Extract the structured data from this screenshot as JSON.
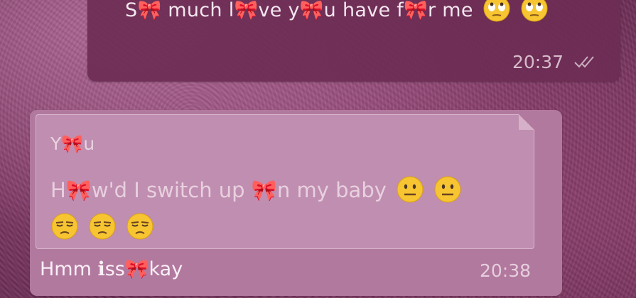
{
  "messages": {
    "outgoing": {
      "text": "S🎀 much l🎀ve y🎀u have f🎀r me",
      "emoji": [
        "face-with-rolling-eyes-emoji",
        "face-with-rolling-eyes-emoji"
      ],
      "time": "20:37",
      "status": "double-check-icon"
    },
    "incoming": {
      "quote": {
        "author": "Y🎀u",
        "text": "H🎀w'd I switch up 🎀n my baby",
        "emoji": [
          "neutral-face-emoji",
          "neutral-face-emoji",
          "unamused-face-emoji",
          "unamused-face-emoji",
          "unamused-face-emoji"
        ]
      },
      "text": "Hmm ℹss🎀kay",
      "time": "20:38"
    }
  },
  "colors": {
    "background": "#9b4c7d",
    "outgoing_bubble": "#6c2c54",
    "incoming_bubble": "#b2799f",
    "quote_box": "#c08eb0"
  }
}
